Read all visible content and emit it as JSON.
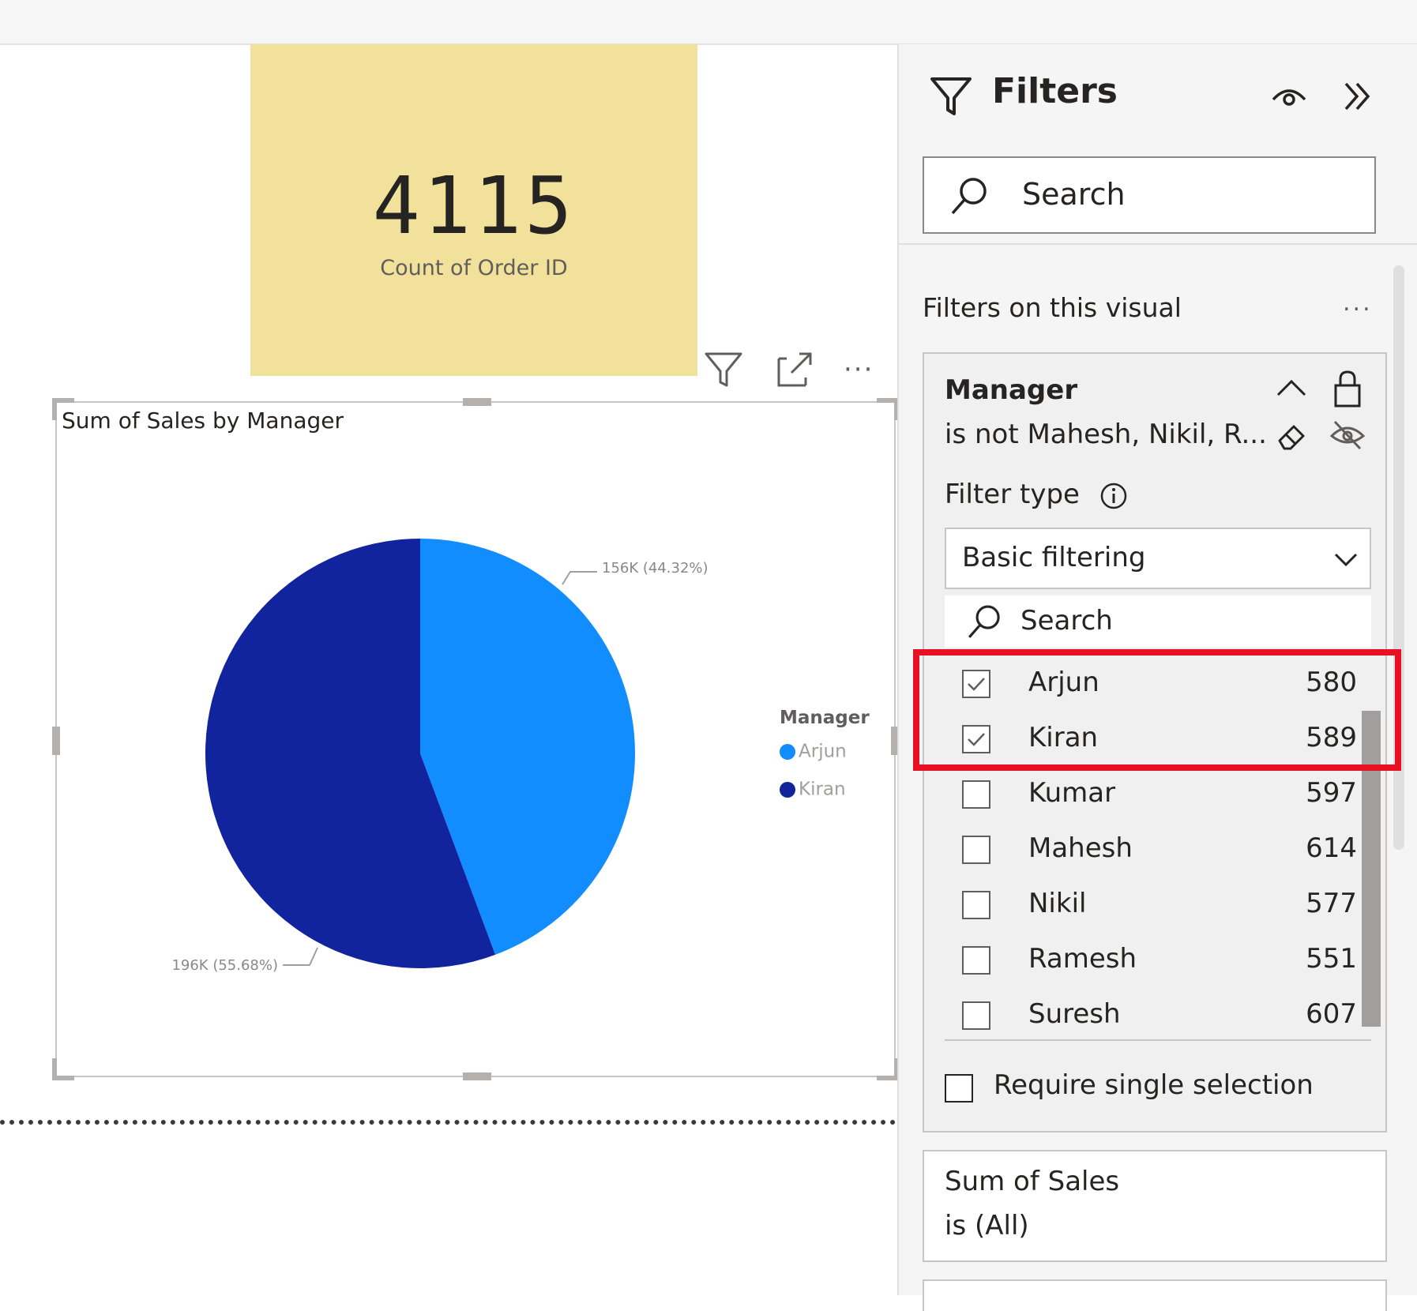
{
  "card": {
    "value": "4115",
    "label": "Count of Order ID"
  },
  "visual_header": {
    "icons": [
      "filter-icon",
      "focus-mode-icon",
      "more-options-icon"
    ],
    "more": "···"
  },
  "pie_visual": {
    "title": "Sum of Sales by Manager",
    "legend_title": "Manager",
    "data_labels": [
      "156K (44.32%)",
      "196K (55.68%)"
    ]
  },
  "chart_data": {
    "type": "pie",
    "title": "Sum of Sales by Manager",
    "legend_title": "Manager",
    "legend_placement": "right",
    "categories": [
      "Arjun",
      "Kiran"
    ],
    "values": [
      156,
      196
    ],
    "value_unit": "K",
    "percentages": [
      44.32,
      55.68
    ],
    "colors": [
      "#118dff",
      "#12239e"
    ]
  },
  "filters": {
    "title": "Filters",
    "search_placeholder": "Search",
    "section_label": "Filters on this visual",
    "section_more": "...",
    "manager_filter": {
      "title": "Manager",
      "description": "is not Mahesh, Nikil, R...",
      "filter_type_label": "Filter type",
      "filter_type_value": "Basic filtering",
      "search_placeholder": "Search",
      "items": [
        {
          "name": "Arjun",
          "count": "580",
          "checked": true
        },
        {
          "name": "Kiran",
          "count": "589",
          "checked": true
        },
        {
          "name": "Kumar",
          "count": "597",
          "checked": false
        },
        {
          "name": "Mahesh",
          "count": "614",
          "checked": false
        },
        {
          "name": "Nikil",
          "count": "577",
          "checked": false
        },
        {
          "name": "Ramesh",
          "count": "551",
          "checked": false
        },
        {
          "name": "Suresh",
          "count": "607",
          "checked": false
        }
      ],
      "require_single_label": "Require single selection"
    },
    "sales_filter": {
      "title": "Sum of Sales",
      "description": "is (All)"
    }
  },
  "colors": {
    "card_bg": "#f1e19a",
    "highlight": "#e81123"
  }
}
